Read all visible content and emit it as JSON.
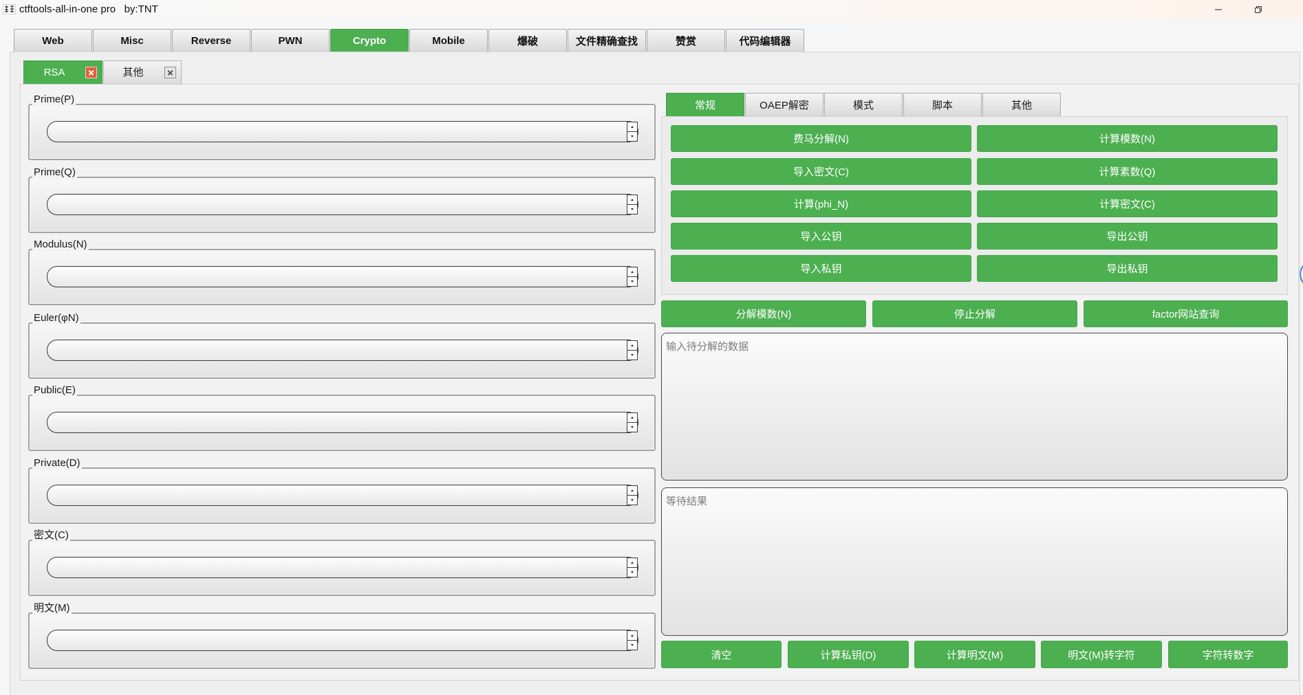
{
  "window": {
    "title": "ctftools-all-in-one pro   by:TNT",
    "icons": {
      "app": "app-icon",
      "minimize": "minimize-icon",
      "maximize": "restore-icon"
    }
  },
  "main_tabs": [
    {
      "label": "Web"
    },
    {
      "label": "Misc"
    },
    {
      "label": "Reverse"
    },
    {
      "label": "PWN"
    },
    {
      "label": "Crypto",
      "active": true
    },
    {
      "label": "Mobile"
    },
    {
      "label": "爆破"
    },
    {
      "label": "文件精确查找"
    },
    {
      "label": "赞赏"
    },
    {
      "label": "代码编辑器"
    }
  ],
  "crypto_tabs": [
    {
      "label": "RSA",
      "active": true,
      "close_icon": "close-icon"
    },
    {
      "label": "其他",
      "close_icon": "close-icon"
    }
  ],
  "rsa_fields": [
    {
      "label": "Prime(P)",
      "value": ""
    },
    {
      "label": "Prime(Q)",
      "value": ""
    },
    {
      "label": "Modulus(N)",
      "value": ""
    },
    {
      "label": "Euler(φN)",
      "value": ""
    },
    {
      "label": "Public(E)",
      "value": ""
    },
    {
      "label": "Private(D)",
      "value": ""
    },
    {
      "label": "密文(C)",
      "value": ""
    },
    {
      "label": "明文(M)",
      "value": ""
    }
  ],
  "field_spin_icons": {
    "up": "spin-up-icon",
    "down": "spin-down-icon"
  },
  "function_tabs": [
    {
      "label": "常规",
      "active": true
    },
    {
      "label": "OAEP解密"
    },
    {
      "label": "模式"
    },
    {
      "label": "脚本"
    },
    {
      "label": "其他"
    }
  ],
  "general_actions": {
    "left": [
      "费马分解(N)",
      "导入密文(C)",
      "计算(phi_N)",
      "导入公钥",
      "导入私钥"
    ],
    "right": [
      "计算模数(N)",
      "计算素数(Q)",
      "计算密文(C)",
      "导出公钥",
      "导出私钥"
    ]
  },
  "factor_actions": [
    "分解模数(N)",
    "停止分解",
    "factor网站查询"
  ],
  "factor_input": {
    "placeholder": "输入待分解的数据",
    "value": ""
  },
  "result_output": {
    "placeholder": "等待结果",
    "value": ""
  },
  "bottom_actions": [
    "清空",
    "计算私钥(D)",
    "计算明文(M)",
    "明文(M)转字符",
    "字符转数字"
  ],
  "colors": {
    "accent": "#4caf50",
    "active_close": "#e8603c",
    "inactive_tab": "#dcdcdc"
  }
}
